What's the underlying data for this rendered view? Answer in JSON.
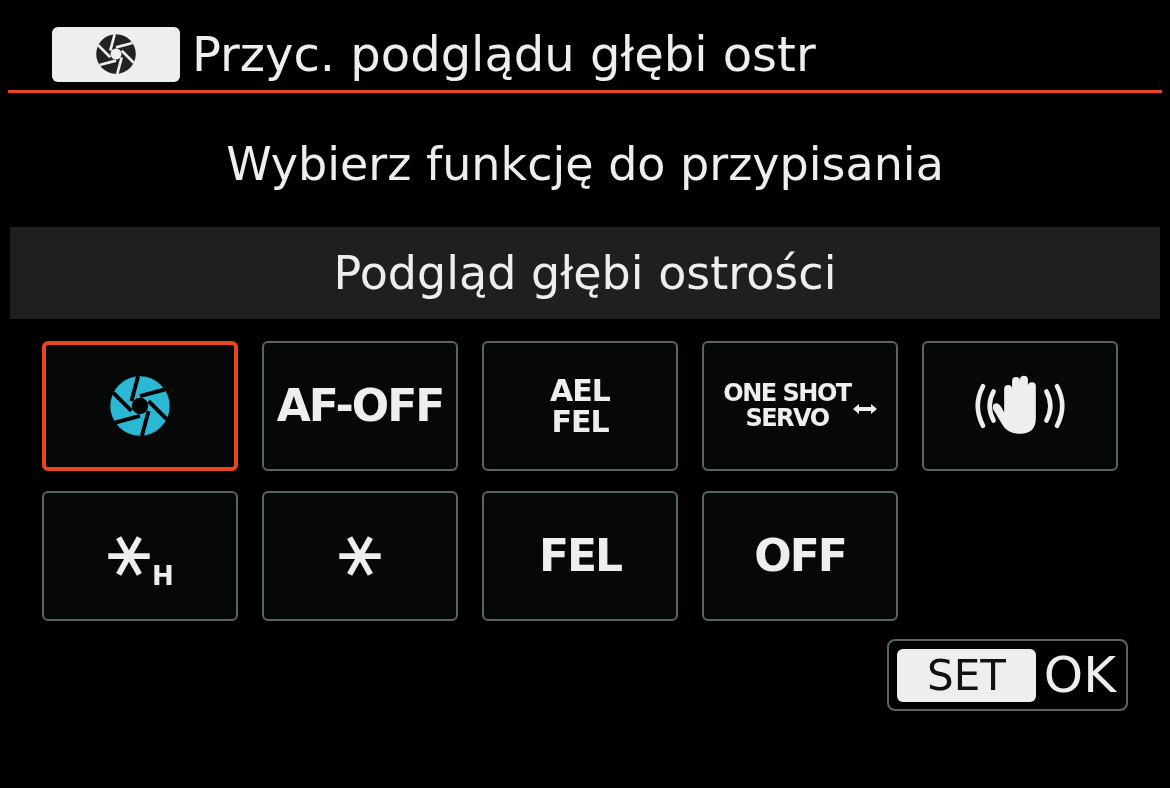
{
  "header": {
    "title": "Przyc. podglądu głębi ostr"
  },
  "prompt": "Wybierz funkcję do przypisania",
  "current_function": "Podgląd głębi ostrości",
  "options": [
    {
      "kind": "aperture",
      "selected": true
    },
    {
      "kind": "text",
      "lines": [
        "AF-OFF"
      ],
      "selected": false
    },
    {
      "kind": "text",
      "lines": [
        "AEL",
        "FEL"
      ],
      "selected": false
    },
    {
      "kind": "switch",
      "lines": [
        "ONE SHOT",
        "SERVO"
      ],
      "selected": false
    },
    {
      "kind": "stabilizer",
      "selected": false
    },
    {
      "kind": "star",
      "subscript": "H",
      "selected": false
    },
    {
      "kind": "star",
      "selected": false
    },
    {
      "kind": "text",
      "lines": [
        "FEL"
      ],
      "selected": false
    },
    {
      "kind": "text",
      "lines": [
        "OFF"
      ],
      "selected": false
    }
  ],
  "footer": {
    "key": "SET",
    "label": "OK"
  }
}
